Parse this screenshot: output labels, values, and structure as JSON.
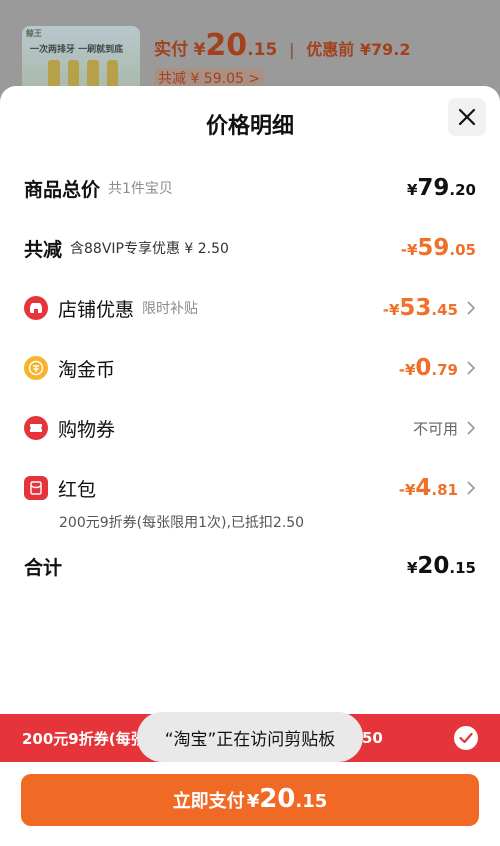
{
  "background": {
    "thumb_tag": "鲸王",
    "thumb_line": "一次两排牙 一刷就到底",
    "paid_label": "实付",
    "paid_symbol": "¥",
    "paid_int": "20",
    "paid_dec": ".15",
    "separator": "|",
    "original_label": "优惠前 ¥79.2",
    "discount_line": "共减 ¥ 59.05 >"
  },
  "sheet": {
    "title": "价格明细",
    "close_icon": "close-icon"
  },
  "rows": {
    "total": {
      "label": "商品总价",
      "note": "共1件宝贝",
      "sym": "¥",
      "int": "79",
      "dec": ".20"
    },
    "discount": {
      "label": "共减",
      "note": "含88VIP专享优惠 ¥ 2.50",
      "sym": "-¥",
      "int": "59",
      "dec": ".05"
    },
    "store": {
      "label": "店铺优惠",
      "note": "限时补贴",
      "sym": "-¥",
      "int": "53",
      "dec": ".45",
      "icon": "store-icon"
    },
    "coin": {
      "label": "淘金币",
      "sym": "-¥",
      "int": "0",
      "dec": ".79",
      "icon": "coin-icon"
    },
    "voucher": {
      "label": "购物券",
      "status": "不可用",
      "icon": "ticket-icon"
    },
    "hongbao": {
      "label": "红包",
      "sym": "-¥",
      "int": "4",
      "dec": ".81",
      "sub": "200元9折券(每张限用1次),已抵扣2.50",
      "icon": "red-envelope-icon"
    },
    "sum": {
      "label": "合计",
      "sym": "¥",
      "int": "20",
      "dec": ".15"
    }
  },
  "banner": {
    "text_left": "200元9折券(每张",
    "text_right": "50"
  },
  "toast": {
    "text": "“淘宝”正在访问剪贴板"
  },
  "pay_button": {
    "label": "立即支付",
    "sym": "¥",
    "int": "20",
    "dec": ".15"
  },
  "colors": {
    "accent_orange": "#f0702a",
    "banner_red": "#e5353a",
    "pay_orange": "#f06a26"
  }
}
